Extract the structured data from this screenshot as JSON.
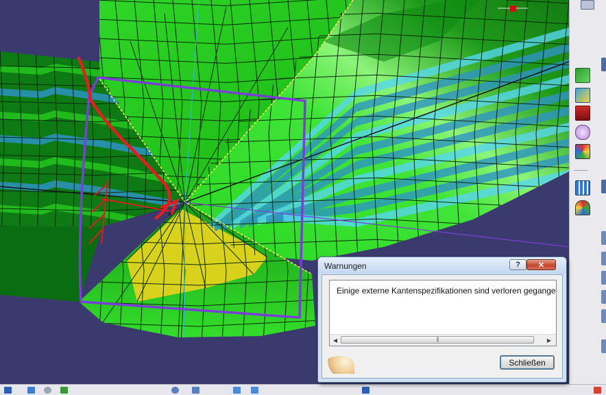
{
  "viewport": {
    "name": "3D FE mesh viewport",
    "colors": {
      "background": "#3a3a6e",
      "mesh_green": "#24c51e",
      "mesh_dark_green": "#0d7a13",
      "mesh_light_green": "#3fe437",
      "mesh_blue": "#2e93c4",
      "mesh_cyan": "#56d6ef",
      "mesh_yellow": "#d9d21c",
      "annotation_red": "#e02020",
      "annotation_purple": "#7a3fd6"
    }
  },
  "right_toolbar": {
    "icons": [
      "mesh-part-icon",
      "surface-mesh-icon",
      "solid-mesh-icon",
      "edge-capture-icon",
      "quality-analysis-icon",
      "mesh-edit-icon",
      "coloring-icon"
    ]
  },
  "bottom_toolbar": {
    "icons": [
      "select-icon",
      "snap-icon",
      "zoom-icon",
      "pan-icon",
      "rotate-icon",
      "fit-all-icon",
      "view-icon",
      "normal-view-icon"
    ]
  },
  "dialog": {
    "title": "Warnungen",
    "help_label": "?",
    "close_label": "✕",
    "message": "Einige externe Kantenspezifikationen sind verloren gegangen.",
    "scroll_left": "◀",
    "scroll_right": "▶",
    "scroll_grip": "|||",
    "button_label": "Schließen"
  }
}
